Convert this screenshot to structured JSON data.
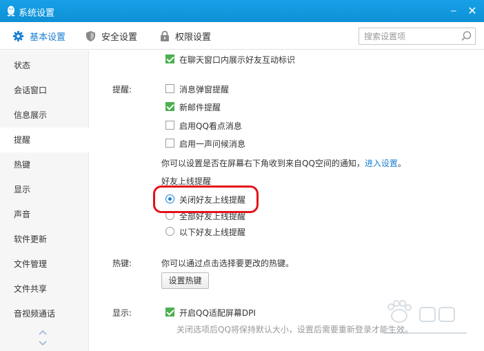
{
  "window": {
    "title": "系统设置",
    "minimize_glyph": "‒",
    "close_glyph": "✕"
  },
  "toolbar": {
    "tabs": [
      {
        "label": "基本设置",
        "icon": "gear-icon",
        "active": true
      },
      {
        "label": "安全设置",
        "icon": "shield-icon",
        "active": false
      },
      {
        "label": "权限设置",
        "icon": "lock-icon",
        "active": false
      }
    ],
    "search": {
      "placeholder": "搜索设置项",
      "value": ""
    }
  },
  "sidebar": {
    "items": [
      {
        "label": "状态"
      },
      {
        "label": "会话窗口"
      },
      {
        "label": "信息展示"
      },
      {
        "label": "提醒",
        "active": true
      },
      {
        "label": "热键"
      },
      {
        "label": "显示"
      },
      {
        "label": "声音"
      },
      {
        "label": "软件更新"
      },
      {
        "label": "文件管理"
      },
      {
        "label": "文件共享"
      },
      {
        "label": "音视频通话"
      }
    ]
  },
  "main": {
    "top_option": {
      "label": "在聊天窗口内展示好友互动标识",
      "checked": true
    },
    "reminders": {
      "section_label": "提醒:",
      "options": [
        {
          "label": "消息弹窗提醒",
          "checked": false
        },
        {
          "label": "新邮件提醒",
          "checked": true
        },
        {
          "label": "启用QQ看点消息",
          "checked": false
        },
        {
          "label": "启用一声问候消息",
          "checked": false
        }
      ],
      "note_text": "你可以设置是否在屏幕右下角收到来自QQ空间的通知，",
      "note_link": "进入设置",
      "note_end": "。",
      "online_title": "好友上线提醒",
      "online_options": [
        {
          "label": "关闭好友上线提醒",
          "selected": true
        },
        {
          "label": "全部好友上线提醒",
          "selected": false
        },
        {
          "label": "以下好友上线提醒",
          "selected": false
        }
      ]
    },
    "hotkeys": {
      "section_label": "热键:",
      "desc": "你可以通过点击选择要更改的热键。",
      "button_label": "设置热键"
    },
    "display": {
      "section_label": "显示:",
      "option": {
        "label": "开启QQ适配屏幕DPI",
        "checked": true
      },
      "note": "关闭选项后QQ将保持默认大小，设置后需要重新登录才能生效。"
    }
  },
  "colors": {
    "title_bar": "#1296db",
    "accent": "#1a7fd4",
    "checkbox_checked": "#4caf50",
    "highlight": "#e3121a"
  }
}
